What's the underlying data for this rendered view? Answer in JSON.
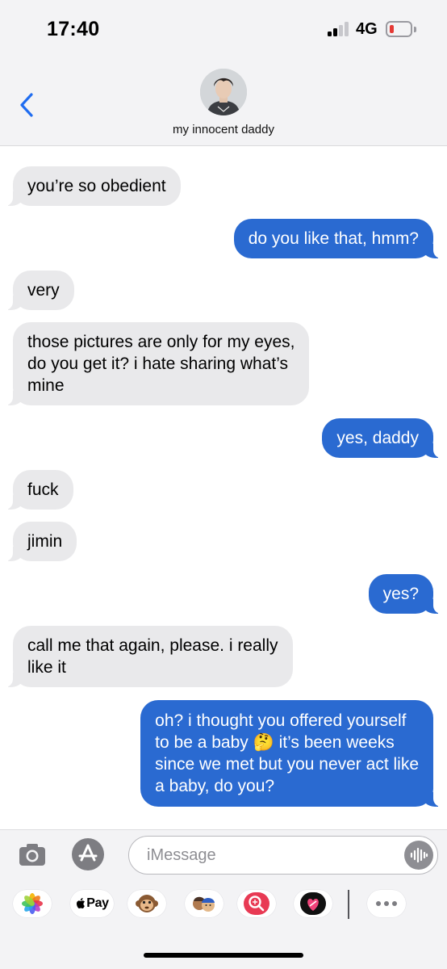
{
  "status_bar": {
    "time": "17:40",
    "network": "4G",
    "signal_bars_active": 2,
    "signal_bars_total": 4,
    "battery_level": 0.1
  },
  "header": {
    "contact_name": "my innocent daddy",
    "back_icon": "chevron-left-icon",
    "accent_color": "#1f6cf0"
  },
  "messages": [
    {
      "direction": "incoming",
      "lines": [
        "you’re so obedient"
      ]
    },
    {
      "direction": "outgoing",
      "lines": [
        "do you like that, hmm?"
      ]
    },
    {
      "direction": "incoming",
      "lines": [
        "very"
      ]
    },
    {
      "direction": "incoming",
      "lines": [
        "those pictures are only for my eyes,",
        "do you get it? i hate sharing what’s",
        "mine"
      ]
    },
    {
      "direction": "outgoing",
      "lines": [
        "yes, daddy"
      ]
    },
    {
      "direction": "incoming",
      "lines": [
        "fuck"
      ]
    },
    {
      "direction": "incoming",
      "lines": [
        "jimin"
      ]
    },
    {
      "direction": "outgoing",
      "lines": [
        "yes?"
      ]
    },
    {
      "direction": "incoming",
      "lines": [
        "call me that again, please. i really",
        "like it"
      ]
    },
    {
      "direction": "outgoing",
      "lines": [
        "oh? i thought you offered yourself",
        "to be a baby 🤔 it’s been weeks",
        "since we met but you never act like",
        "a baby, do you?"
      ]
    }
  ],
  "colors": {
    "outgoing_bubble": "#2a6ad1",
    "incoming_bubble": "#e9e9eb",
    "battery_low": "#e53935"
  },
  "compose": {
    "placeholder": "iMessage",
    "camera_icon": "camera-icon",
    "appstore_icon": "appstore-icon",
    "voice_icon": "audio-waveform-icon"
  },
  "app_drawer": {
    "apple_pay_label": "Pay",
    "apps": [
      "photos-icon",
      "apple-pay-icon",
      "monkey-emoji-icon",
      "memoji-icon",
      "web-search-icon",
      "heart-app-icon",
      "more-icon"
    ]
  }
}
